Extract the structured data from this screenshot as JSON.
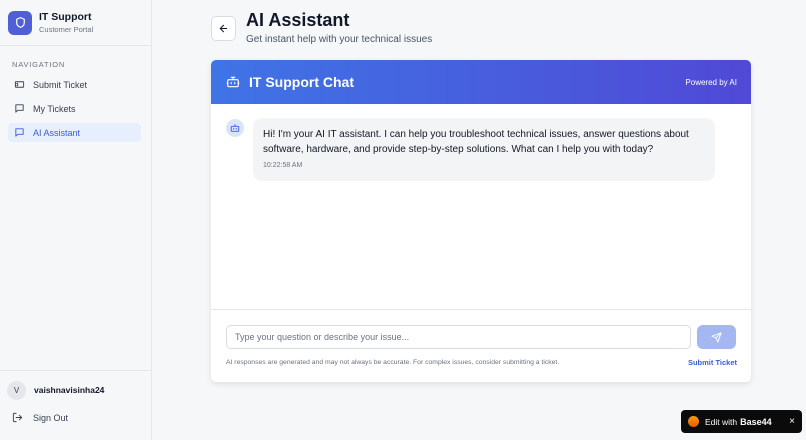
{
  "brand": {
    "title": "IT Support",
    "subtitle": "Customer Portal",
    "icon": "shield-icon"
  },
  "sidebar": {
    "heading": "NAVIGATION",
    "items": [
      {
        "label": "Submit Ticket",
        "icon": "ticket-icon",
        "active": false
      },
      {
        "label": "My Tickets",
        "icon": "message-square-icon",
        "active": false
      },
      {
        "label": "AI Assistant",
        "icon": "message-square-icon",
        "active": true
      }
    ]
  },
  "user": {
    "initial": "V",
    "name": "vaishnavisinha24",
    "signout_label": "Sign Out"
  },
  "header": {
    "title": "AI Assistant",
    "subtitle": "Get instant help with your technical issues"
  },
  "chat": {
    "title": "IT Support Chat",
    "powered": "Powered by AI",
    "messages": [
      {
        "sender": "bot",
        "text": "Hi! I'm your AI IT assistant. I can help you troubleshoot technical issues, answer questions about software, hardware, and provide step-by-step solutions. What can I help you with today?",
        "time": "10:22:58 AM"
      }
    ],
    "input_placeholder": "Type your question or describe your issue...",
    "disclaimer": "AI responses are generated and may not always be accurate. For complex issues, consider submitting a ticket.",
    "submit_link": "Submit Ticket"
  },
  "badge": {
    "prefix": "Edit with",
    "brand": "Base44",
    "close": "×"
  },
  "colors": {
    "accent": "#3b5bdb",
    "header_gradient_start": "#3f74e6",
    "header_gradient_end": "#5049d6",
    "send_button": "#a5b7f0"
  }
}
